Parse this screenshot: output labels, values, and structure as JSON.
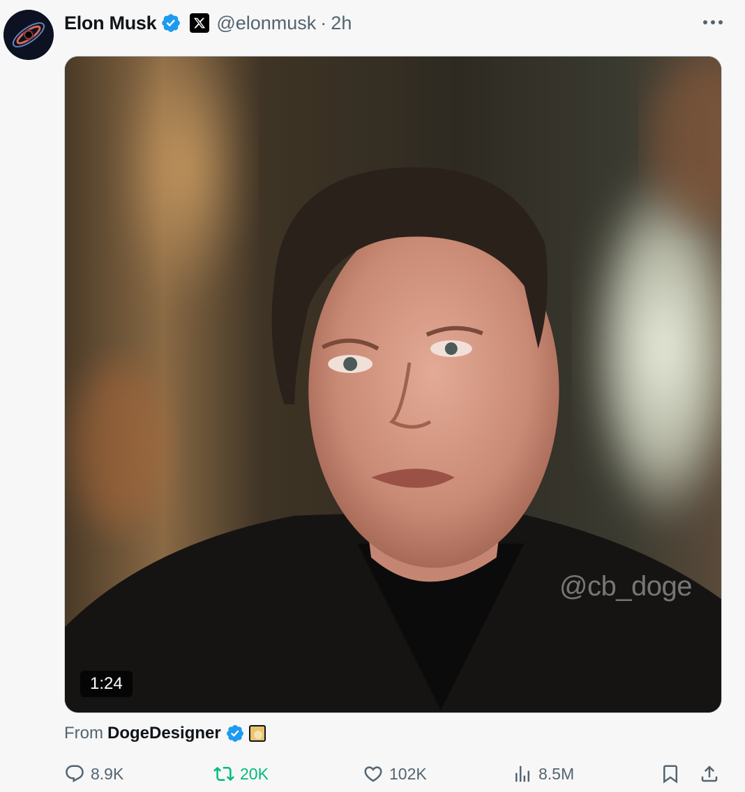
{
  "post": {
    "author_name": "Elon Musk",
    "handle": "@elonmusk",
    "separator": "·",
    "time": "2h",
    "more_icon": "more-dots-icon"
  },
  "media": {
    "watermark": "@cb_doge",
    "duration": "1:24"
  },
  "source": {
    "prefix": "From",
    "name": "DogeDesigner"
  },
  "actions": {
    "replies": "8.9K",
    "reposts": "20K",
    "likes": "102K",
    "views": "8.5M"
  },
  "colors": {
    "verified": "#1d9bf0",
    "repost_active": "#00ba7c",
    "muted_text": "#536471"
  }
}
